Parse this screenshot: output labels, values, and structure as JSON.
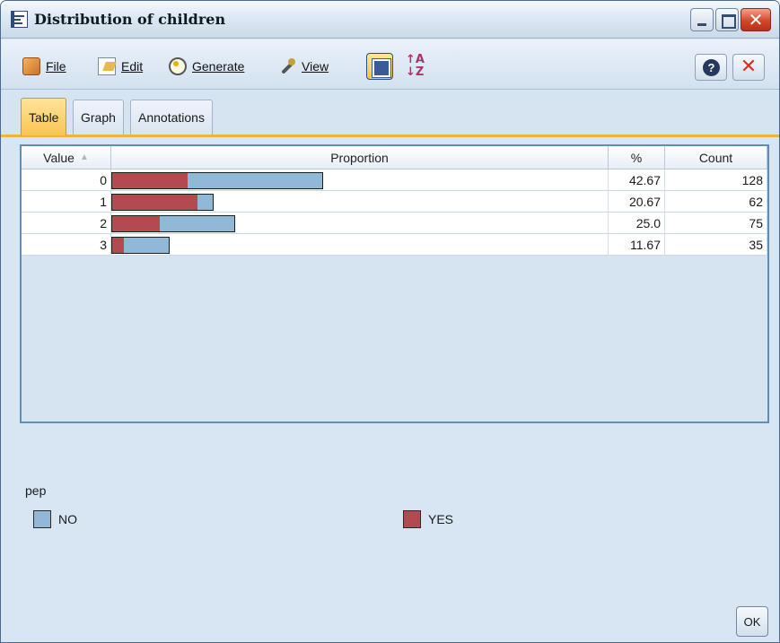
{
  "window": {
    "title": "Distribution of children",
    "title_icon": "table-report-icon",
    "controls": [
      "minimize-icon",
      "maximize-icon",
      "close-icon"
    ]
  },
  "menubar": {
    "items": [
      {
        "label": "File",
        "icon": "file-icon"
      },
      {
        "label": "Edit",
        "icon": "edit-icon"
      },
      {
        "label": "Generate",
        "icon": "generate-icon"
      },
      {
        "label": "View",
        "icon": "view-icon"
      }
    ],
    "close_glyph": "✕",
    "help_glyph": "?"
  },
  "tabs": [
    {
      "label": "Table",
      "active": true
    },
    {
      "label": "Graph",
      "active": false
    },
    {
      "label": "Annotations",
      "active": false
    }
  ],
  "table": {
    "columns": [
      "Value",
      "Proportion",
      "%",
      "Count"
    ],
    "rows": [
      {
        "value": "0",
        "percent": "42.67",
        "count": "128",
        "yes_fraction": 0.36
      },
      {
        "value": "1",
        "percent": "20.67",
        "count": "62",
        "yes_fraction": 0.85
      },
      {
        "value": "2",
        "percent": "25.0",
        "count": "75",
        "yes_fraction": 0.39
      },
      {
        "value": "3",
        "percent": "11.67",
        "count": "35",
        "yes_fraction": 0.2
      }
    ]
  },
  "legend": {
    "title": "pep",
    "items": [
      {
        "label": "NO",
        "color": "#8fb9d6"
      },
      {
        "label": "YES",
        "color": "#b34a50"
      }
    ]
  },
  "buttons": {
    "ok": "OK"
  },
  "colors": {
    "accent": "#f0b43a",
    "no": "#8fb9d6",
    "yes": "#b34a50"
  }
}
